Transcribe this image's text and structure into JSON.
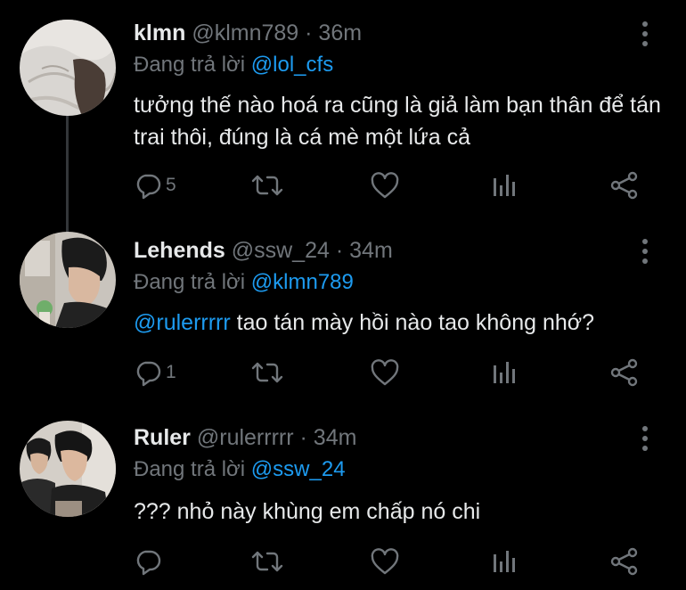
{
  "colors": {
    "background": "#000000",
    "text": "#e7e9ea",
    "muted": "#71767b",
    "link": "#1d9bf0",
    "thread_line": "#333639"
  },
  "tweets": [
    {
      "name": "klmn",
      "handle": "@klmn789",
      "separator": "·",
      "time": "36m",
      "reply_prefix": "Đang trả lời",
      "reply_to": "@lol_cfs",
      "text": "tưởng thế nào hoá ra cũng là giả làm bạn thân để tán trai thôi, đúng là cá mè một lứa cả",
      "reply_count": "5",
      "icons": [
        "reply-icon",
        "retweet-icon",
        "like-icon",
        "analytics-icon",
        "share-icon",
        "more-icon"
      ]
    },
    {
      "name": "Lehends",
      "handle": "@ssw_24",
      "separator": "·",
      "time": "34m",
      "reply_prefix": "Đang trả lời",
      "reply_to": "@klmn789",
      "mention": "@rulerrrrr",
      "text": " tao tán mày hồi nào tao không nhớ?",
      "reply_count": "1",
      "icons": [
        "reply-icon",
        "retweet-icon",
        "like-icon",
        "analytics-icon",
        "share-icon",
        "more-icon"
      ]
    },
    {
      "name": "Ruler",
      "handle": "@rulerrrrr",
      "separator": "·",
      "time": "34m",
      "reply_prefix": "Đang trả lời",
      "reply_to": "@ssw_24",
      "text": "??? nhỏ này khùng em chấp nó chi",
      "reply_count": "",
      "icons": [
        "reply-icon",
        "retweet-icon",
        "like-icon",
        "analytics-icon",
        "share-icon",
        "more-icon"
      ]
    }
  ]
}
